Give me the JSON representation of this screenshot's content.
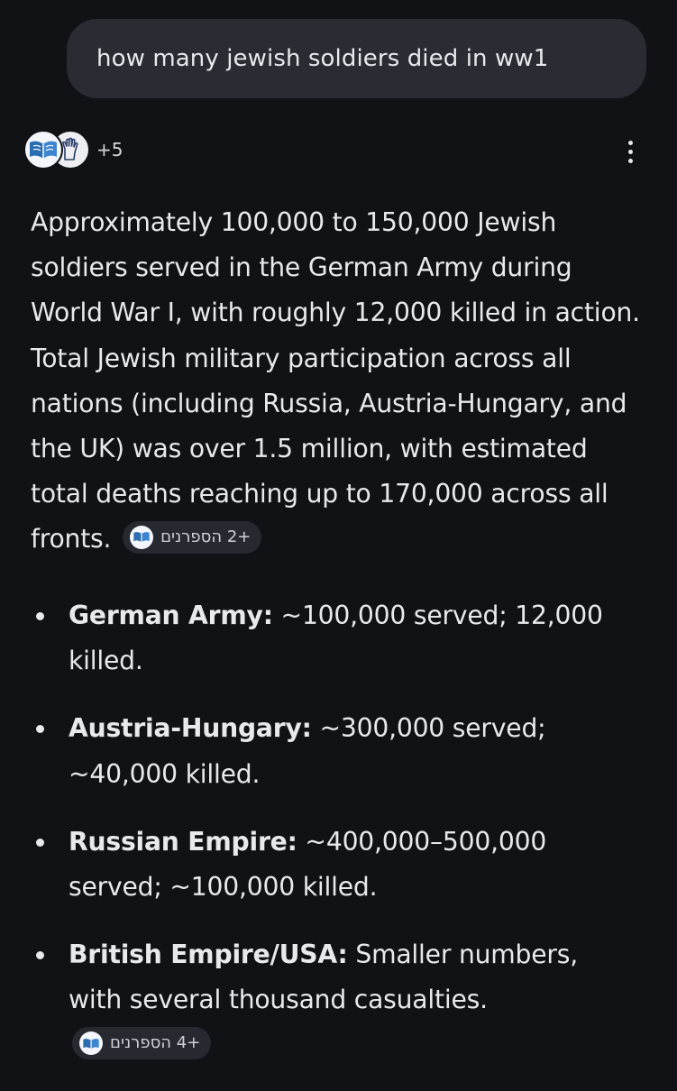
{
  "query": {
    "text": "how many jewish soldiers died in ww1"
  },
  "sources": {
    "count_label": "+5"
  },
  "answer": {
    "paragraph": "Approximately 100,000 to 150,000 Jewish soldiers served in the German Army during World War I, with roughly 12,000 killed in action. Total Jewish military participation across all nations (including Russia, Austria-Hungary, and the UK) was over 1.5 million, with estimated total deaths reaching up to 170,000 across all fronts.",
    "paragraph_citation": "+2 הספרנים"
  },
  "bullets": [
    {
      "label": "German Army:",
      "text": " ~100,000 served; 12,000 killed."
    },
    {
      "label": "Austria-Hungary:",
      "text": " ~300,000 served; ~40,000 killed."
    },
    {
      "label": "Russian Empire:",
      "text": " ~400,000–500,000 served; ~100,000 killed."
    },
    {
      "label": "British Empire/USA:",
      "text": " Smaller numbers, with several thousand casualties.",
      "citation": "+4 הספרנים"
    }
  ],
  "icons": {
    "source_1": "book-icon",
    "source_2": "hand-icon",
    "more": "more-vert-icon",
    "citation": "book-icon"
  },
  "colors": {
    "background": "#111216",
    "query_bubble": "#2a2c33",
    "chip": "#272930",
    "text": "#e8e9ec",
    "book_blue": "#2a6db0"
  }
}
